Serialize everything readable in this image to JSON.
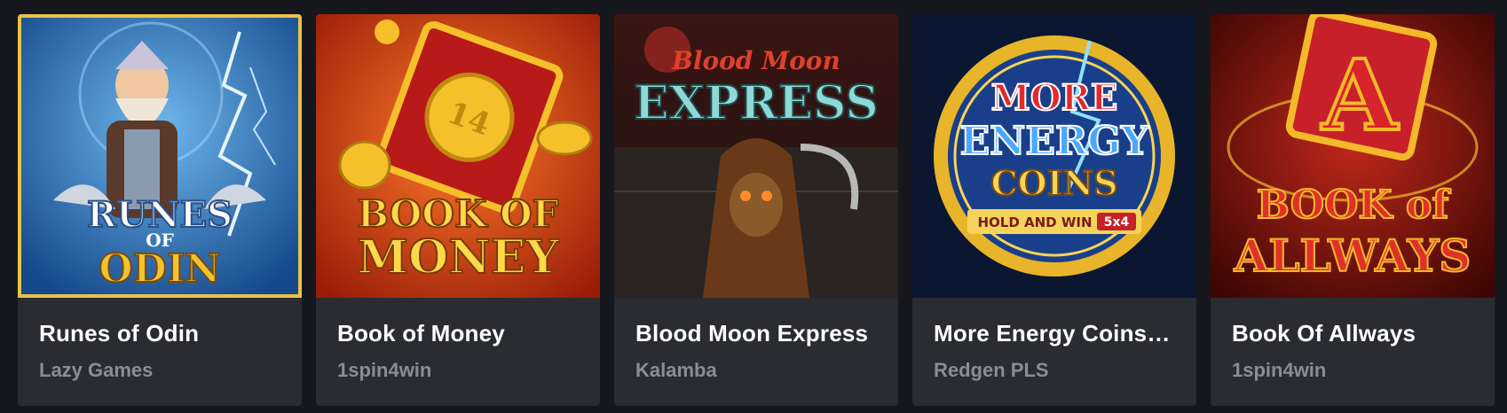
{
  "games": [
    {
      "title": "Runes of Odin",
      "provider": "Lazy Games",
      "art_lines": [
        "RUNES",
        "OF",
        "ODIN"
      ],
      "icon": "runes-of-odin-thumbnail",
      "colors": {
        "bg": "#1d5fa8",
        "accent": "#f2c230",
        "text": "#ffffff"
      }
    },
    {
      "title": "Book of Money",
      "provider": "1spin4win",
      "art_lines": [
        "BOOK OF",
        "MONEY"
      ],
      "icon": "book-of-money-thumbnail",
      "colors": {
        "bg": "#c5320f",
        "accent": "#f6c02a",
        "text": "#ffd84a"
      }
    },
    {
      "title": "Blood Moon Express",
      "provider": "Kalamba",
      "art_lines": [
        "Blood Moon",
        "EXPRESS"
      ],
      "icon": "blood-moon-express-thumbnail",
      "colors": {
        "bg": "#2b1a17",
        "accent": "#c7322a",
        "text": "#8fd8d6"
      }
    },
    {
      "title": "More Energy Coins: ...",
      "provider": "Redgen PLS",
      "art_lines": [
        "MORE",
        "ENERGY",
        "COINS",
        "HOLD AND WIN",
        "5x4"
      ],
      "icon": "more-energy-coins-thumbnail",
      "colors": {
        "bg": "#0d1a3a",
        "accent": "#e8b52a",
        "text": "#e22a2a"
      }
    },
    {
      "title": "Book Of Allways",
      "provider": "1spin4win",
      "art_lines": [
        "A",
        "BOOK of",
        "ALLWAYS"
      ],
      "icon": "book-of-allways-thumbnail",
      "colors": {
        "bg": "#6e0d0a",
        "accent": "#f3b92a",
        "text": "#e0302a"
      }
    }
  ]
}
